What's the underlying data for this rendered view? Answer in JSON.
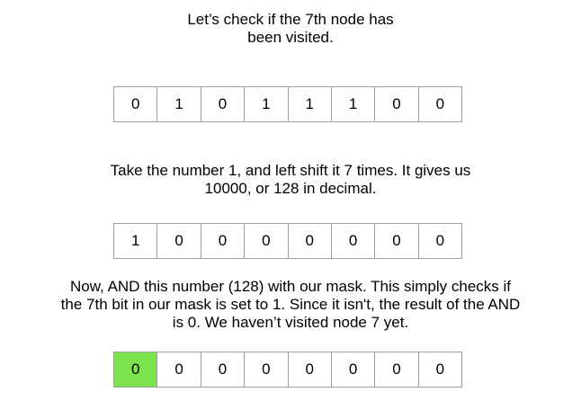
{
  "captions": {
    "step1": "Let’s check if the 7th node has\nbeen visited.",
    "step2": "Take the number 1, and left shift it 7 times. It gives us\n10000, or 128 in decimal.",
    "step3": "Now, AND this number (128) with our mask. This simply checks if\nthe 7th bit in our mask is set to 1. Since it isn't, the result of the AND\nis 0. We haven’t visited node 7 yet."
  },
  "rows": {
    "mask": [
      "0",
      "1",
      "0",
      "1",
      "1",
      "1",
      "0",
      "0"
    ],
    "shifted": [
      "1",
      "0",
      "0",
      "0",
      "0",
      "0",
      "0",
      "0"
    ],
    "result": [
      "0",
      "0",
      "0",
      "0",
      "0",
      "0",
      "0",
      "0"
    ]
  },
  "highlight": {
    "row": "result",
    "cell_index": 0,
    "color": "#7ae24a"
  }
}
